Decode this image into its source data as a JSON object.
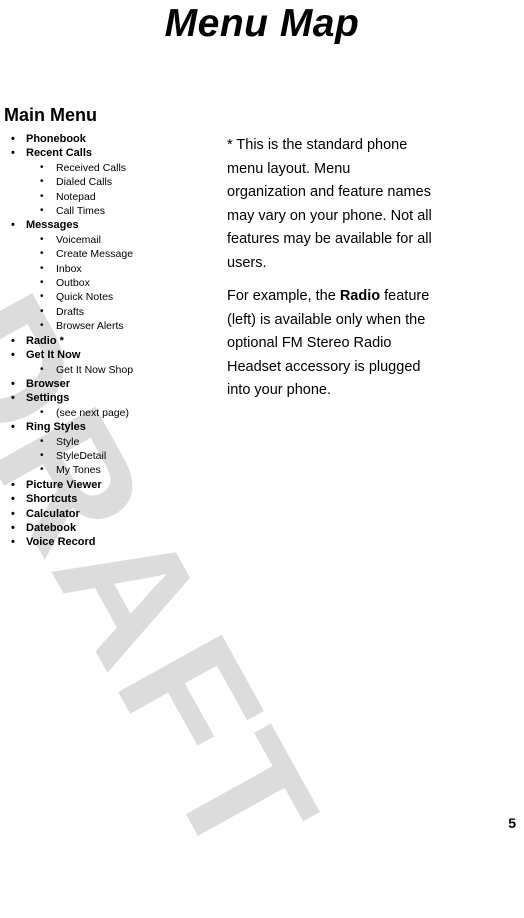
{
  "page": {
    "title": "Menu Map",
    "number": "5",
    "watermark": "DRAFT",
    "watermark_color": "#dcdcdc",
    "text_color": "#000000",
    "background_color": "#ffffff"
  },
  "left_column": {
    "heading": "Main Menu",
    "bullet_glyph": "•",
    "items": [
      {
        "label": "Phonebook",
        "level": 1
      },
      {
        "label": "Recent Calls",
        "level": 1
      },
      {
        "label": "Received Calls",
        "level": 2
      },
      {
        "label": "Dialed Calls",
        "level": 2
      },
      {
        "label": "Notepad",
        "level": 2
      },
      {
        "label": "Call Times",
        "level": 2
      },
      {
        "label": "Messages",
        "level": 1
      },
      {
        "label": "Voicemail",
        "level": 2
      },
      {
        "label": "Create Message",
        "level": 2
      },
      {
        "label": "Inbox",
        "level": 2
      },
      {
        "label": "Outbox",
        "level": 2
      },
      {
        "label": "Quick Notes",
        "level": 2
      },
      {
        "label": "Drafts",
        "level": 2
      },
      {
        "label": "Browser Alerts",
        "level": 2
      },
      {
        "label": "Radio *",
        "level": 1
      },
      {
        "label": "Get It Now",
        "level": 1
      },
      {
        "label": "Get It Now Shop",
        "level": 2
      },
      {
        "label": "Browser",
        "level": 1
      },
      {
        "label": "Settings",
        "level": 1
      },
      {
        "label": "(see next page)",
        "level": 2
      },
      {
        "label": "Ring Styles",
        "level": 1
      },
      {
        "label": "Style",
        "level": 2
      },
      {
        "label": "StyleDetail",
        "level": 2
      },
      {
        "label": "My Tones",
        "level": 2
      },
      {
        "label": "Picture Viewer",
        "level": 1
      },
      {
        "label": "Shortcuts",
        "level": 1
      },
      {
        "label": "Calculator",
        "level": 1
      },
      {
        "label": "Datebook",
        "level": 1
      },
      {
        "label": "Voice Record",
        "level": 1
      }
    ]
  },
  "right_column": {
    "paragraphs": [
      {
        "runs": [
          {
            "text": "* This is the standard phone menu layout. Menu organization and feature names may vary on your phone. Not all features may be available for all users.",
            "bold": false
          }
        ]
      },
      {
        "runs": [
          {
            "text": "For example, the ",
            "bold": false
          },
          {
            "text": "Radio",
            "bold": true
          },
          {
            "text": " feature (left) is available only when the optional FM Stereo Radio Headset accessory is plugged into your phone.",
            "bold": false
          }
        ]
      }
    ]
  }
}
